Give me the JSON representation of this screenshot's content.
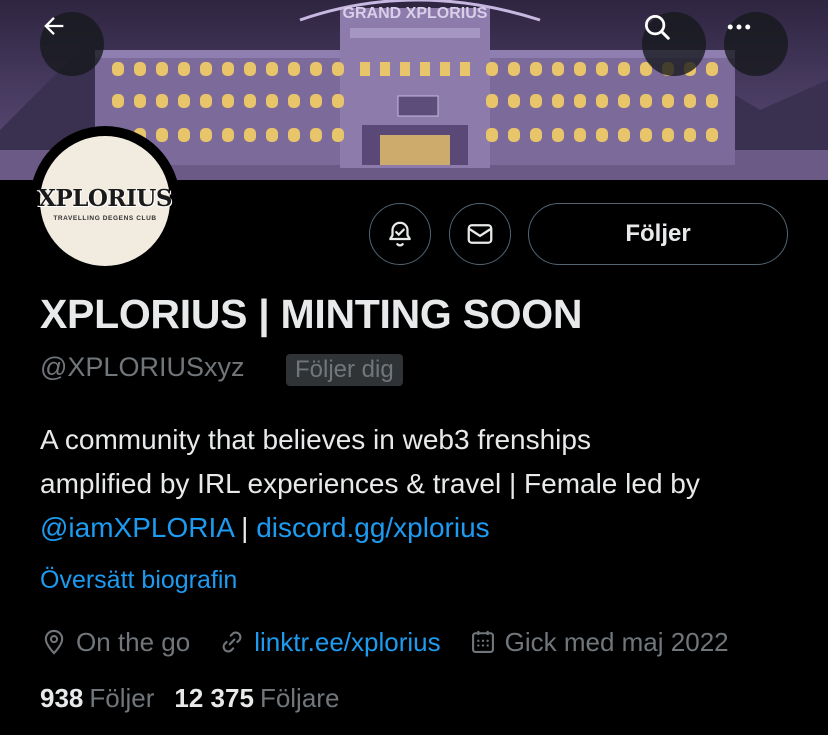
{
  "banner": {
    "sign_text": "GRAND XPLORIUS",
    "door_sign": "GRAND XPLORIUS"
  },
  "header_buttons": {
    "back_icon": "arrow-left-icon",
    "search_icon": "search-icon",
    "more_icon": "more-horizontal-icon"
  },
  "avatar": {
    "logo_text": "XPLORIUS",
    "tagline": "TRAVELLING DEGENS CLUB"
  },
  "actions": {
    "notify_icon": "bell-check-icon",
    "message_icon": "envelope-icon",
    "follow_label": "Följer"
  },
  "profile": {
    "name": "XPLORIUS | MINTING SOON",
    "handle": "@XPLORIUSxyz",
    "follows_you": "Följer dig",
    "bio_line1": "A community that believes in web3 frenships",
    "bio_line2": "amplified by IRL experiences & travel | Female led by",
    "bio_mention": "@iamXPLORIA",
    "bio_sep": " | ",
    "bio_link": "discord.gg/xplorius",
    "translate": "Översätt biografin",
    "location": "On the go",
    "website": "linktr.ee/xplorius",
    "joined": "Gick med maj 2022",
    "following_count": "938",
    "following_label": "Följer",
    "followers_count": "12 375",
    "followers_label": "Följare"
  },
  "colors": {
    "accent": "#1d9bf0",
    "background": "#000000",
    "text_primary": "#e7e9ea",
    "text_secondary": "#71767b"
  }
}
